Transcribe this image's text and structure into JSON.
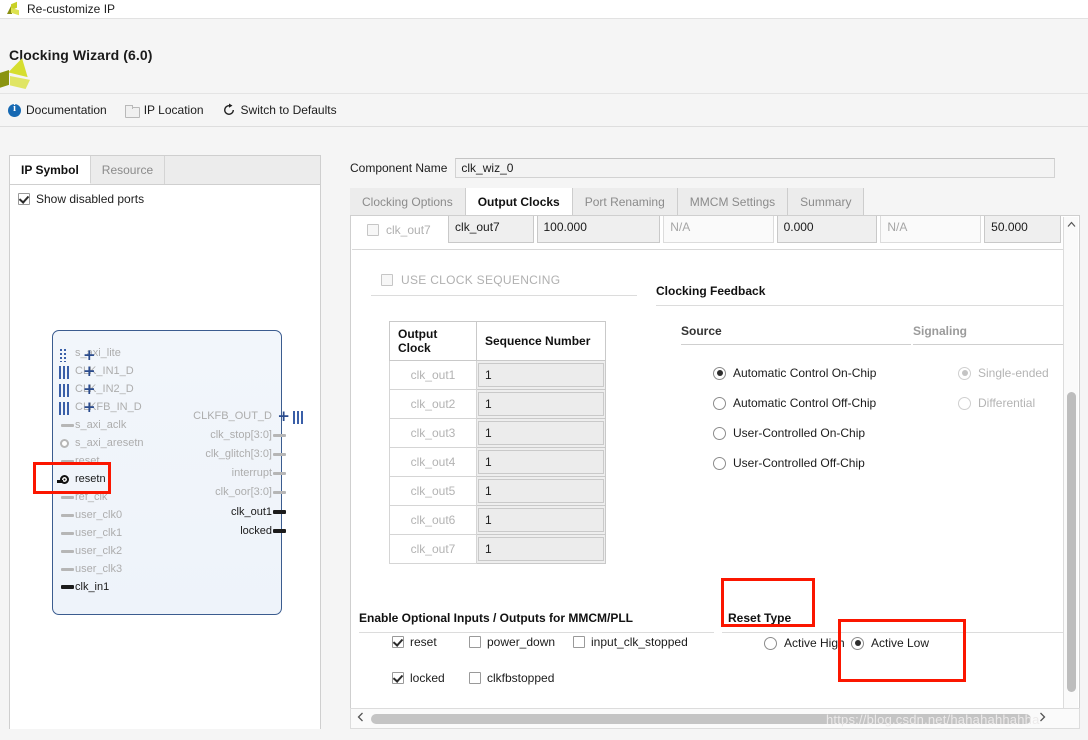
{
  "window": {
    "title": "Re-customize IP",
    "app_icon": "xilinx-logo-icon"
  },
  "header": {
    "title": "Clocking Wizard (6.0)",
    "logo": "xilinx-logo-icon"
  },
  "toolbar": {
    "items": [
      {
        "label": "Documentation",
        "icon": "info-icon"
      },
      {
        "label": "IP Location",
        "icon": "folder-icon"
      },
      {
        "label": "Switch to Defaults",
        "icon": "refresh-icon"
      }
    ]
  },
  "left_panel": {
    "tabs": [
      {
        "label": "IP Symbol",
        "active": true
      },
      {
        "label": "Resource",
        "active": false
      }
    ],
    "show_disabled_ports": {
      "label": "Show disabled ports",
      "checked": true
    },
    "symbol": {
      "inputs": [
        {
          "label": "s_axi_lite",
          "enabled": false,
          "pin": "bus-dashed",
          "expandable": true
        },
        {
          "label": "CLK_IN1_D",
          "enabled": false,
          "pin": "bus",
          "expandable": true
        },
        {
          "label": "CLK_IN2_D",
          "enabled": false,
          "pin": "bus",
          "expandable": true
        },
        {
          "label": "CLKFB_IN_D",
          "enabled": false,
          "pin": "bus",
          "expandable": true
        },
        {
          "label": "s_axi_aclk",
          "enabled": false,
          "pin": "stub",
          "expandable": false
        },
        {
          "label": "s_axi_aresetn",
          "enabled": false,
          "pin": "dot",
          "expandable": false
        },
        {
          "label": "reset",
          "enabled": false,
          "pin": "stub",
          "expandable": false
        },
        {
          "label": "resetn",
          "enabled": true,
          "pin": "dot-on",
          "expandable": false
        },
        {
          "label": "ref_clk",
          "enabled": false,
          "pin": "stub",
          "expandable": false
        },
        {
          "label": "user_clk0",
          "enabled": false,
          "pin": "stub",
          "expandable": false
        },
        {
          "label": "user_clk1",
          "enabled": false,
          "pin": "stub",
          "expandable": false
        },
        {
          "label": "user_clk2",
          "enabled": false,
          "pin": "stub",
          "expandable": false
        },
        {
          "label": "user_clk3",
          "enabled": false,
          "pin": "stub",
          "expandable": false
        },
        {
          "label": "clk_in1",
          "enabled": true,
          "pin": "stub-on",
          "expandable": false
        }
      ],
      "outputs": [
        {
          "label": "CLKFB_OUT_D",
          "enabled": false,
          "pin": "bus",
          "expandable": true
        },
        {
          "label": "clk_stop[3:0]",
          "enabled": false,
          "pin": "stub",
          "expandable": false
        },
        {
          "label": "clk_glitch[3:0]",
          "enabled": false,
          "pin": "stub",
          "expandable": false
        },
        {
          "label": "interrupt",
          "enabled": false,
          "pin": "stub",
          "expandable": false
        },
        {
          "label": "clk_oor[3:0]",
          "enabled": false,
          "pin": "stub",
          "expandable": false
        },
        {
          "label": "clk_out1",
          "enabled": true,
          "pin": "stub-on",
          "expandable": false
        },
        {
          "label": "locked",
          "enabled": true,
          "pin": "stub-on",
          "expandable": false
        }
      ]
    },
    "highlight": {
      "target": "resetn",
      "color": "#fb1600"
    }
  },
  "right_panel": {
    "component_name": {
      "label": "Component Name",
      "value": "clk_wiz_0"
    },
    "tabs": [
      {
        "label": "Clocking Options",
        "active": false
      },
      {
        "label": "Output Clocks",
        "active": true
      },
      {
        "label": "Port Renaming",
        "active": false
      },
      {
        "label": "MMCM Settings",
        "active": false
      },
      {
        "label": "Summary",
        "active": false
      }
    ],
    "clipped_row": {
      "checkbox_label": "clk_out7",
      "checkbox_checked": false,
      "cells": [
        "clk_out7",
        "100.000",
        "N/A",
        "0.000",
        "N/A",
        "50.000"
      ]
    },
    "use_clock_sequencing": {
      "label": "USE CLOCK SEQUENCING",
      "checked": false,
      "enabled": false
    },
    "sequence_table": {
      "headers": [
        "Output Clock",
        "Sequence Number"
      ],
      "rows": [
        {
          "clock": "clk_out1",
          "sequence": "1"
        },
        {
          "clock": "clk_out2",
          "sequence": "1"
        },
        {
          "clock": "clk_out3",
          "sequence": "1"
        },
        {
          "clock": "clk_out4",
          "sequence": "1"
        },
        {
          "clock": "clk_out5",
          "sequence": "1"
        },
        {
          "clock": "clk_out6",
          "sequence": "1"
        },
        {
          "clock": "clk_out7",
          "sequence": "1"
        }
      ]
    },
    "clocking_feedback": {
      "title": "Clocking Feedback",
      "source": {
        "title": "Source",
        "options": [
          {
            "label": "Automatic Control On-Chip",
            "selected": true,
            "enabled": true
          },
          {
            "label": "Automatic Control Off-Chip",
            "selected": false,
            "enabled": true
          },
          {
            "label": "User-Controlled On-Chip",
            "selected": false,
            "enabled": true
          },
          {
            "label": "User-Controlled Off-Chip",
            "selected": false,
            "enabled": true
          }
        ]
      },
      "signaling": {
        "title": "Signaling",
        "options": [
          {
            "label": "Single-ended",
            "selected": true,
            "enabled": false
          },
          {
            "label": "Differential",
            "selected": false,
            "enabled": false
          }
        ]
      }
    },
    "optional_io": {
      "title": "Enable Optional Inputs / Outputs for MMCM/PLL",
      "checkboxes": [
        {
          "label": "reset",
          "checked": true
        },
        {
          "label": "power_down",
          "checked": false
        },
        {
          "label": "input_clk_stopped",
          "checked": false
        },
        {
          "label": "locked",
          "checked": true
        },
        {
          "label": "clkfbstopped",
          "checked": false
        }
      ]
    },
    "reset_type": {
      "title": "Reset Type",
      "options": [
        {
          "label": "Active High",
          "selected": false
        },
        {
          "label": "Active Low",
          "selected": true
        }
      ],
      "highlight_color": "#fb1600"
    }
  },
  "watermark": {
    "text": "https://blog.csdn.net/hahahahhahha"
  },
  "scrollbars": {
    "vertical": {
      "up_arrow": "chevron-up-icon",
      "down_arrow": "chevron-down-icon"
    },
    "horizontal": {
      "left_arrow": "chevron-left-icon",
      "right_arrow": "chevron-right-icon"
    }
  }
}
